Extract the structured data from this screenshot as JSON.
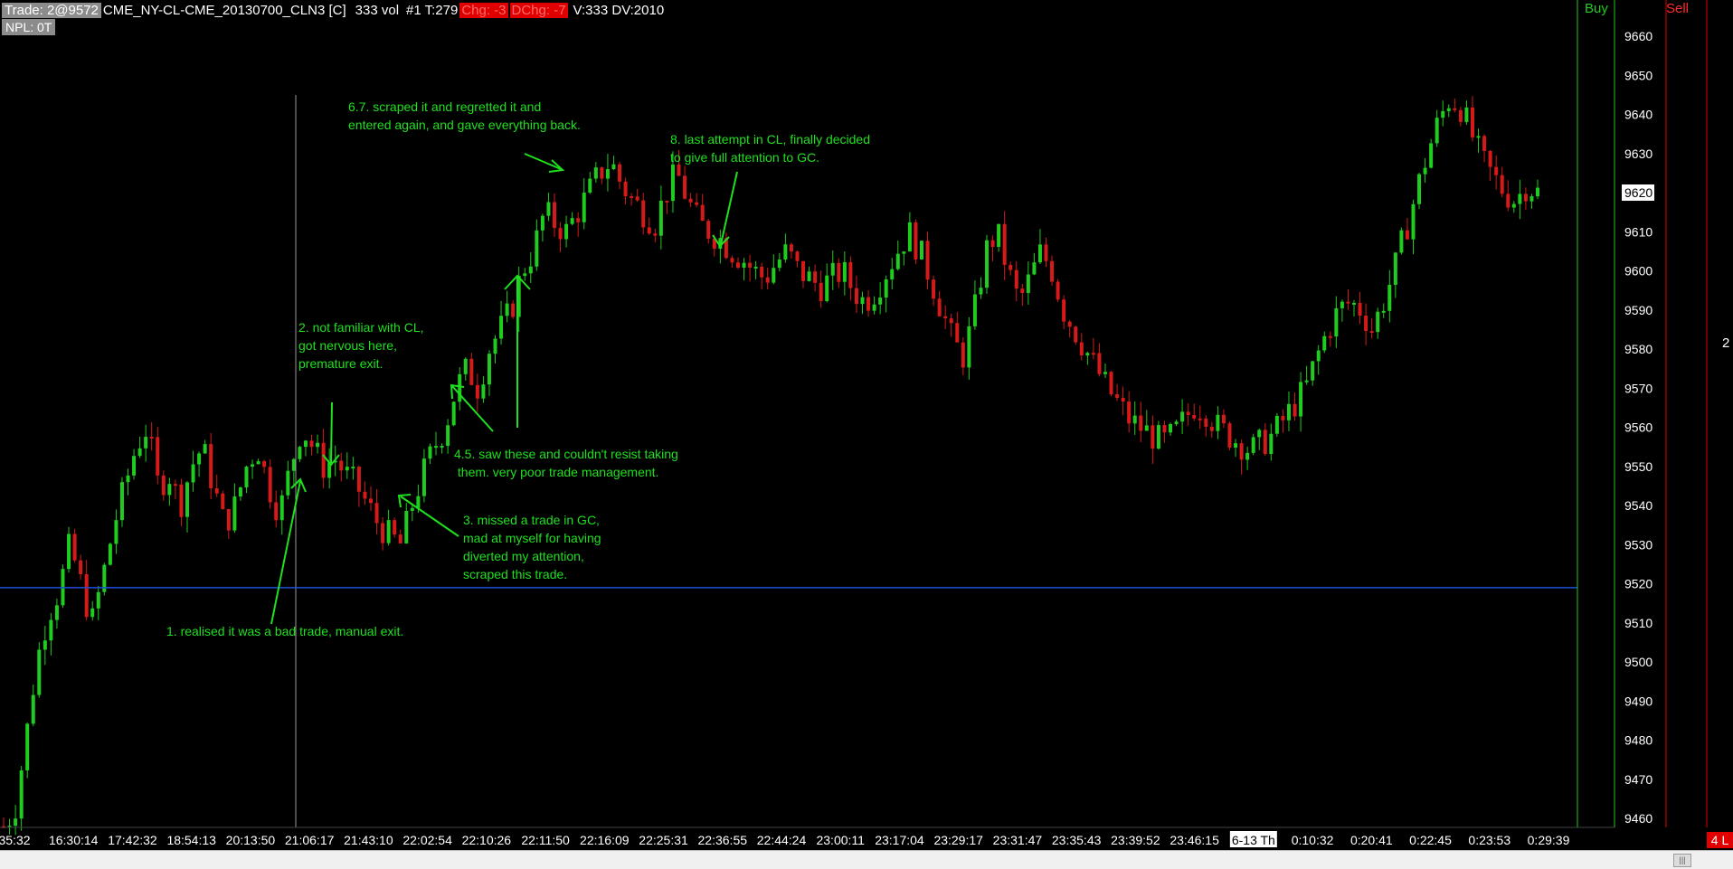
{
  "header": {
    "trade": "Trade: 2@9572",
    "instrument": "CME_NY-CL-CME_20130700_CLN3 [C]",
    "vol": "333 vol",
    "bar_info": "#1 T:279",
    "chg": "Chg: -3",
    "dchg": "DChg: -7",
    "volume_info": "V:333 DV:2010",
    "npl": "NPL: 0T"
  },
  "columns": {
    "buy": "Buy",
    "sell": "Sell"
  },
  "side_value": "2",
  "badge": "4 L",
  "price_axis": {
    "labels": [
      "9660",
      "9650",
      "9640",
      "9630",
      "9620",
      "9610",
      "9600",
      "9590",
      "9580",
      "9570",
      "9560",
      "9550",
      "9540",
      "9530",
      "9520",
      "9510",
      "9500",
      "9490",
      "9480",
      "9470",
      "9460"
    ],
    "current_price": "9620"
  },
  "time_axis": {
    "labels": [
      "35:32",
      "16:30:14",
      "17:42:32",
      "18:54:13",
      "20:13:50",
      "21:06:17",
      "21:43:10",
      "22:02:54",
      "22:10:26",
      "22:11:50",
      "22:16:09",
      "22:25:31",
      "22:36:55",
      "22:44:24",
      "23:00:11",
      "23:17:04",
      "23:29:17",
      "23:31:47",
      "23:35:43",
      "23:39:52",
      "23:46:15",
      "6-13 Th",
      "0:10:32",
      "0:20:41",
      "0:22:45",
      "0:23:53",
      "0:29:39"
    ],
    "highlight": "6-13 Th"
  },
  "chart_data": {
    "type": "candlestick",
    "ylim": [
      9457,
      9665
    ],
    "horizontal_line": 9519,
    "close_path": [
      9458,
      9462,
      9480,
      9500,
      9512,
      9518,
      9530,
      9520,
      9510,
      9522,
      9535,
      9545,
      9555,
      9560,
      9545,
      9548,
      9540,
      9550,
      9555,
      9545,
      9535,
      9540,
      9550,
      9555,
      9545,
      9538,
      9550,
      9560,
      9555,
      9550,
      9552,
      9548,
      9545,
      9540,
      9535,
      9532,
      9530,
      9540,
      9548,
      9555,
      9560,
      9570,
      9575,
      9570,
      9580,
      9585,
      9590,
      9600,
      9605,
      9615,
      9612,
      9610,
      9615,
      9620,
      9625,
      9628,
      9622,
      9618,
      9615,
      9612,
      9620,
      9625,
      9618,
      9612,
      9610,
      9608,
      9605,
      9603,
      9600,
      9598,
      9602,
      9605,
      9600,
      9598,
      9596,
      9598,
      9600,
      9595,
      9592,
      9595,
      9600,
      9605,
      9610,
      9605,
      9598,
      9590,
      9582,
      9578,
      9590,
      9605,
      9610,
      9600,
      9592,
      9598,
      9605,
      9600,
      9590,
      9585,
      9580,
      9575,
      9570,
      9566,
      9562,
      9560,
      9558,
      9556,
      9558,
      9562,
      9566,
      9564,
      9560,
      9558,
      9556,
      9554,
      9556,
      9558,
      9562,
      9566,
      9570,
      9578,
      9585,
      9590,
      9592,
      9590,
      9585,
      9592,
      9600,
      9610,
      9620,
      9630,
      9638,
      9644,
      9642,
      9635,
      9628,
      9624,
      9620,
      9618,
      9622,
      9620
    ],
    "candles": 260
  },
  "annotations": [
    {
      "id": "1",
      "text": "1. realised it was a bad trade, manual exit."
    },
    {
      "id": "2",
      "text": "2. not familiar with CL,\ngot nervous here,\npremature exit."
    },
    {
      "id": "3",
      "text": "3. missed a trade in GC,\nmad at myself for having\ndiverted my attention,\nscraped this trade."
    },
    {
      "id": "45",
      "text": "4.5. saw these and couldn't resist taking\n them. very poor trade management."
    },
    {
      "id": "67",
      "text": "6.7. scraped it and regretted it and\nentered again, and gave everything back."
    },
    {
      "id": "8",
      "text": "8. last attempt in CL, finally decided\nto give full attention to GC."
    }
  ],
  "colors": {
    "up": "#1fcc1f",
    "down": "#d61a1a",
    "annotation": "#1fe01f",
    "level_line": "#1f4fd6",
    "grid_line": "#888888"
  }
}
